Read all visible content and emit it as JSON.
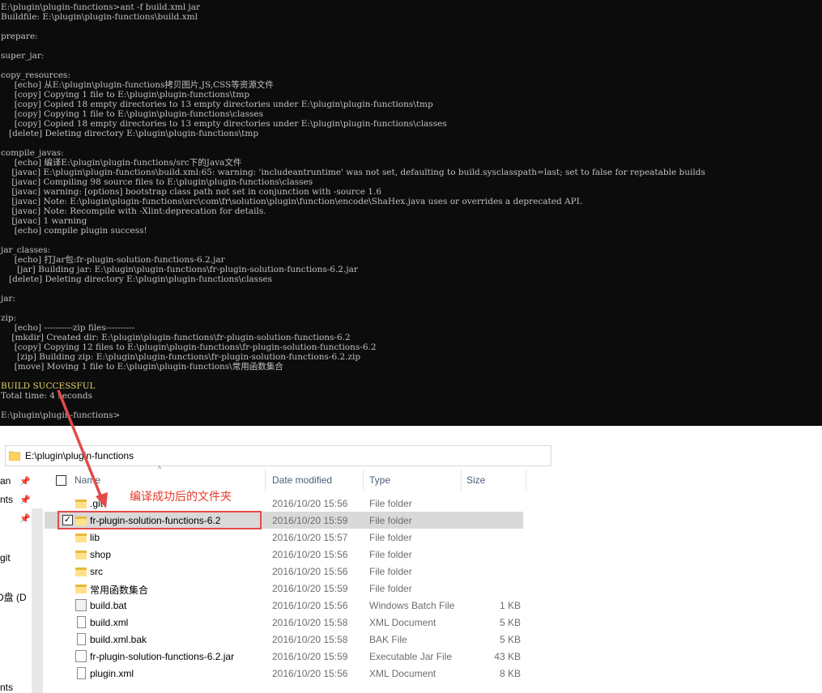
{
  "console": {
    "lines": [
      {
        "text": "E:\\plugin\\plugin-functions>ant -f build.xml jar"
      },
      {
        "text": "Buildfile: E:\\plugin\\plugin-functions\\build.xml"
      },
      {
        "text": ""
      },
      {
        "text": "prepare:"
      },
      {
        "text": ""
      },
      {
        "text": "super_jar:"
      },
      {
        "text": ""
      },
      {
        "text": "copy_resources:"
      },
      {
        "text": "     [echo] 从E:\\plugin\\plugin-functions拷贝图片,JS,CSS等资源文件"
      },
      {
        "text": "     [copy] Copying 1 file to E:\\plugin\\plugin-functions\\tmp"
      },
      {
        "text": "     [copy] Copied 18 empty directories to 13 empty directories under E:\\plugin\\plugin-functions\\tmp"
      },
      {
        "text": "     [copy] Copying 1 file to E:\\plugin\\plugin-functions\\classes"
      },
      {
        "text": "     [copy] Copied 18 empty directories to 13 empty directories under E:\\plugin\\plugin-functions\\classes"
      },
      {
        "text": "   [delete] Deleting directory E:\\plugin\\plugin-functions\\tmp"
      },
      {
        "text": ""
      },
      {
        "text": "compile_javas:"
      },
      {
        "text": "     [echo] 编译E:\\plugin\\plugin-functions/src下的Java文件"
      },
      {
        "text": "    [javac] E:\\plugin\\plugin-functions\\build.xml:65: warning: 'includeantruntime' was not set, defaulting to build.sysclasspath=last; set to false for repeatable builds"
      },
      {
        "text": "    [javac] Compiling 98 source files to E:\\plugin\\plugin-functions\\classes"
      },
      {
        "text": "    [javac] warning: [options] bootstrap class path not set in conjunction with -source 1.6"
      },
      {
        "text": "    [javac] Note: E:\\plugin\\plugin-functions\\src\\com\\fr\\solution\\plugin\\function\\encode\\ShaHex.java uses or overrides a deprecated API."
      },
      {
        "text": "    [javac] Note: Recompile with -Xlint:deprecation for details."
      },
      {
        "text": "    [javac] 1 warning"
      },
      {
        "text": "     [echo] compile plugin success!"
      },
      {
        "text": ""
      },
      {
        "text": "jar_classes:"
      },
      {
        "text": "     [echo] 打Jar包:fr-plugin-solution-functions-6.2.jar"
      },
      {
        "text": "      [jar] Building jar: E:\\plugin\\plugin-functions\\fr-plugin-solution-functions-6.2.jar"
      },
      {
        "text": "   [delete] Deleting directory E:\\plugin\\plugin-functions\\classes"
      },
      {
        "text": ""
      },
      {
        "text": "jar:"
      },
      {
        "text": ""
      },
      {
        "text": "zip:"
      },
      {
        "text": "     [echo] ----------zip files----------"
      },
      {
        "text": "    [mkdir] Created dir: E:\\plugin\\plugin-functions\\fr-plugin-solution-functions-6.2"
      },
      {
        "text": "     [copy] Copying 12 files to E:\\plugin\\plugin-functions\\fr-plugin-solution-functions-6.2"
      },
      {
        "text": "      [zip] Building zip: E:\\plugin\\plugin-functions\\fr-plugin-solution-functions-6.2.zip"
      },
      {
        "text": "     [move] Moving 1 file to E:\\plugin\\plugin-functions\\常用函数集合"
      },
      {
        "text": ""
      },
      {
        "text": "BUILD SUCCESSFUL",
        "status": "success"
      },
      {
        "text": "Total time: 4 seconds"
      },
      {
        "text": ""
      },
      {
        "text": "E:\\plugin\\plugin-functions>"
      }
    ]
  },
  "explorer": {
    "address": "E:\\plugin\\plugin-functions",
    "nav_items": [
      "an",
      "nts",
      "git",
      "D盘 (D",
      "nts"
    ],
    "columns": {
      "name": "Name",
      "date": "Date modified",
      "type": "Type",
      "size": "Size"
    },
    "files": [
      {
        "name": ".git",
        "date": "2016/10/20 15:56",
        "type": "File folder",
        "size": "",
        "icon": "folder-icon",
        "selected": false
      },
      {
        "name": "fr-plugin-solution-functions-6.2",
        "date": "2016/10/20 15:59",
        "type": "File folder",
        "size": "",
        "icon": "folder-icon",
        "selected": true
      },
      {
        "name": "lib",
        "date": "2016/10/20 15:57",
        "type": "File folder",
        "size": "",
        "icon": "folder-icon",
        "selected": false
      },
      {
        "name": "shop",
        "date": "2016/10/20 15:56",
        "type": "File folder",
        "size": "",
        "icon": "folder-icon",
        "selected": false
      },
      {
        "name": "src",
        "date": "2016/10/20 15:56",
        "type": "File folder",
        "size": "",
        "icon": "folder-icon",
        "selected": false
      },
      {
        "name": "常用函数集合",
        "date": "2016/10/20 15:59",
        "type": "File folder",
        "size": "",
        "icon": "folder-icon",
        "selected": false
      },
      {
        "name": "build.bat",
        "date": "2016/10/20 15:56",
        "type": "Windows Batch File",
        "size": "1 KB",
        "icon": "batch-file-icon",
        "selected": false
      },
      {
        "name": "build.xml",
        "date": "2016/10/20 15:58",
        "type": "XML Document",
        "size": "5 KB",
        "icon": "file-icon",
        "selected": false
      },
      {
        "name": "build.xml.bak",
        "date": "2016/10/20 15:58",
        "type": "BAK File",
        "size": "5 KB",
        "icon": "file-icon",
        "selected": false
      },
      {
        "name": "fr-plugin-solution-functions-6.2.jar",
        "date": "2016/10/20 15:59",
        "type": "Executable Jar File",
        "size": "43 KB",
        "icon": "jar-file-icon",
        "selected": false
      },
      {
        "name": "plugin.xml",
        "date": "2016/10/20 15:56",
        "type": "XML Document",
        "size": "8 KB",
        "icon": "file-icon",
        "selected": false
      }
    ]
  },
  "annotation": {
    "text": "编译成功后的文件夹",
    "color": "#e53b2c"
  },
  "colors": {
    "console_bg": "#0c0c0c",
    "console_text": "#c0c0c0",
    "success_text": "#e7d86a",
    "highlight": "#e34a4a"
  }
}
